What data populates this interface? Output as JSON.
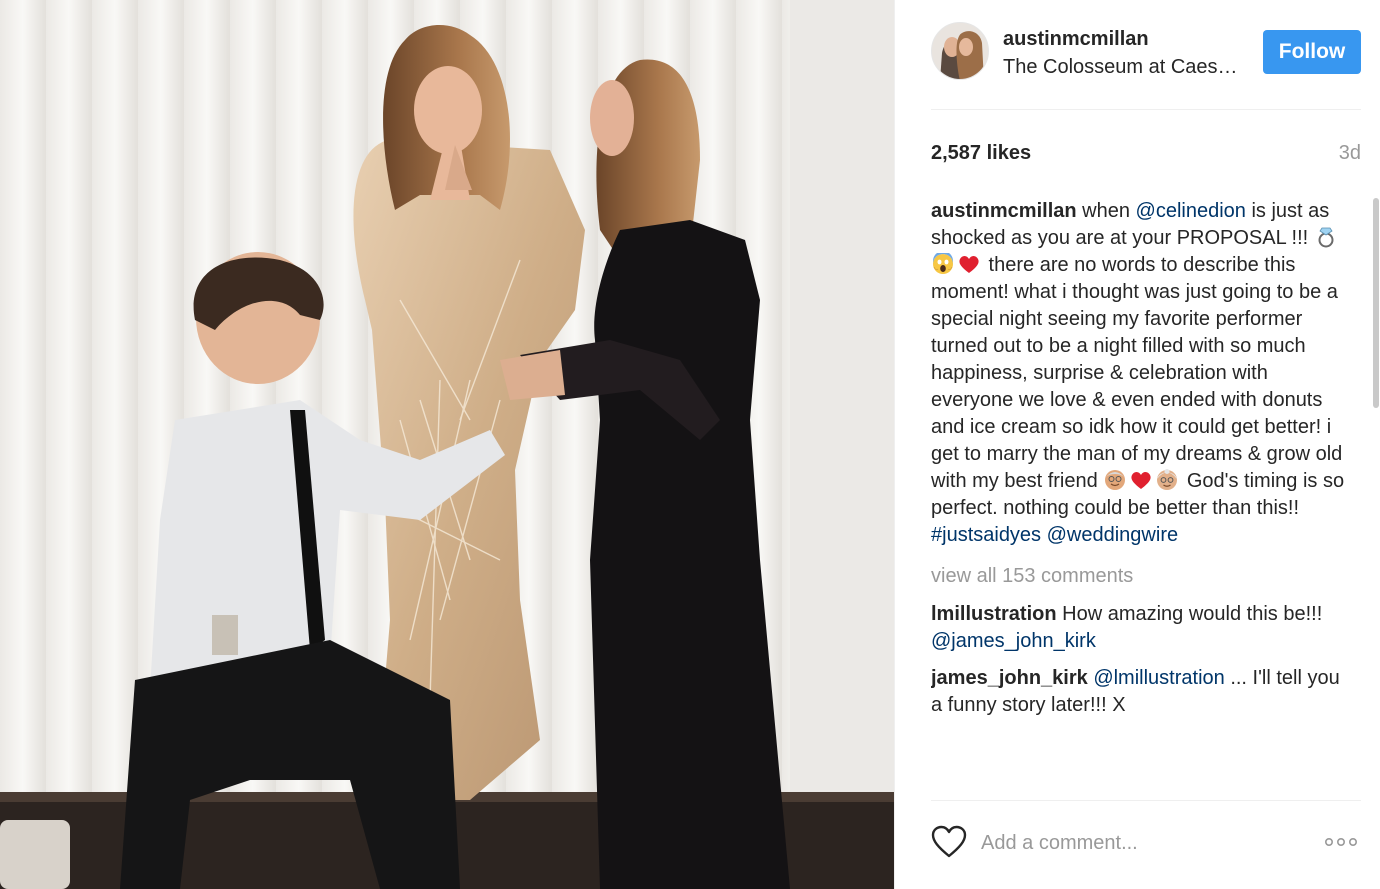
{
  "post": {
    "username": "austinmcmillan",
    "location": "The Colosseum at Caesars Palace",
    "follow_label": "Follow",
    "likes": "2,587 likes",
    "time_ago": "3d"
  },
  "caption": {
    "username": "austinmcmillan",
    "t1": " when ",
    "mention1": "@celinedion",
    "t2": " is just as shocked as you are at your PROPOSAL !!! ",
    "emoji1": [
      "ring-emoji",
      "scream-emoji",
      "heart-emoji"
    ],
    "t3": " there are no words to describe this moment! what i thought was just going to be a special night seeing my favorite performer turned out to be a night filled with so much happiness, surprise & celebration with everyone we love & even ended with donuts and ice cream so idk how it could get better! i get to marry the man of my dreams & grow old with my best friend ",
    "emoji2": [
      "old-man-emoji",
      "heart-emoji",
      "old-woman-emoji"
    ],
    "t4": " God's timing is so perfect. nothing could be better than this!! ",
    "hashtag": "#justsaidyes",
    "mention2": "@weddingwire"
  },
  "view_all": "view all 153 comments",
  "comments": [
    {
      "user": "lmillustration",
      "text": " How amazing would this be!!! ",
      "mention": "@james_john_kirk",
      "after": ""
    },
    {
      "user": "james_john_kirk",
      "text": " ",
      "mention": "@lmillustration",
      "after": " ... I'll tell you a funny story later!!! X"
    }
  ],
  "footer": {
    "placeholder": "Add a comment...",
    "like_icon": "heart-outline-icon",
    "more_icon": "more-options-icon"
  },
  "colors": {
    "follow_button": "#3897f0",
    "link": "#003569",
    "muted": "#999999",
    "text": "#262626"
  }
}
